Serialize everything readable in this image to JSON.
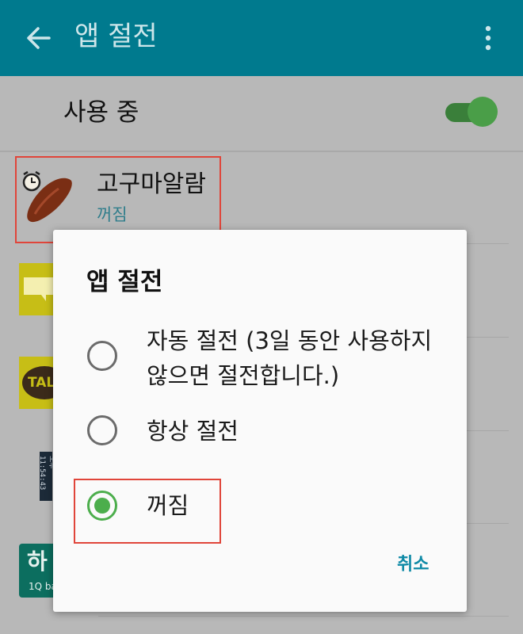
{
  "appbar": {
    "title": "앱 절전",
    "back_icon": "arrow-left-icon",
    "more_icon": "more-vert-icon",
    "color": "#007a8e"
  },
  "master": {
    "label": "사용 중",
    "toggle_on": true
  },
  "apps": [
    {
      "name": "고구마알람",
      "status": "꺼짐",
      "icon": "sweet-potato-alarm-icon"
    },
    {
      "icon": "yellow-app-icon"
    },
    {
      "icon": "kakaotalk-icon",
      "badge": "TAL"
    },
    {
      "icon": "clock-widget-icon",
      "text": "오후 11:54:43"
    },
    {
      "icon": "hana-bank-icon",
      "glyph": "하",
      "text": "1Q ba"
    }
  ],
  "dialog": {
    "title": "앱 절전",
    "options": [
      {
        "line1": "자동 절전 (3일 동안 사용하지",
        "line2": "않으면 절전합니다.)",
        "selected": false
      },
      {
        "label": "항상 절전",
        "selected": false
      },
      {
        "label": "꺼짐",
        "selected": true
      }
    ],
    "cancel": "취소",
    "accent": "#4cae4c"
  }
}
